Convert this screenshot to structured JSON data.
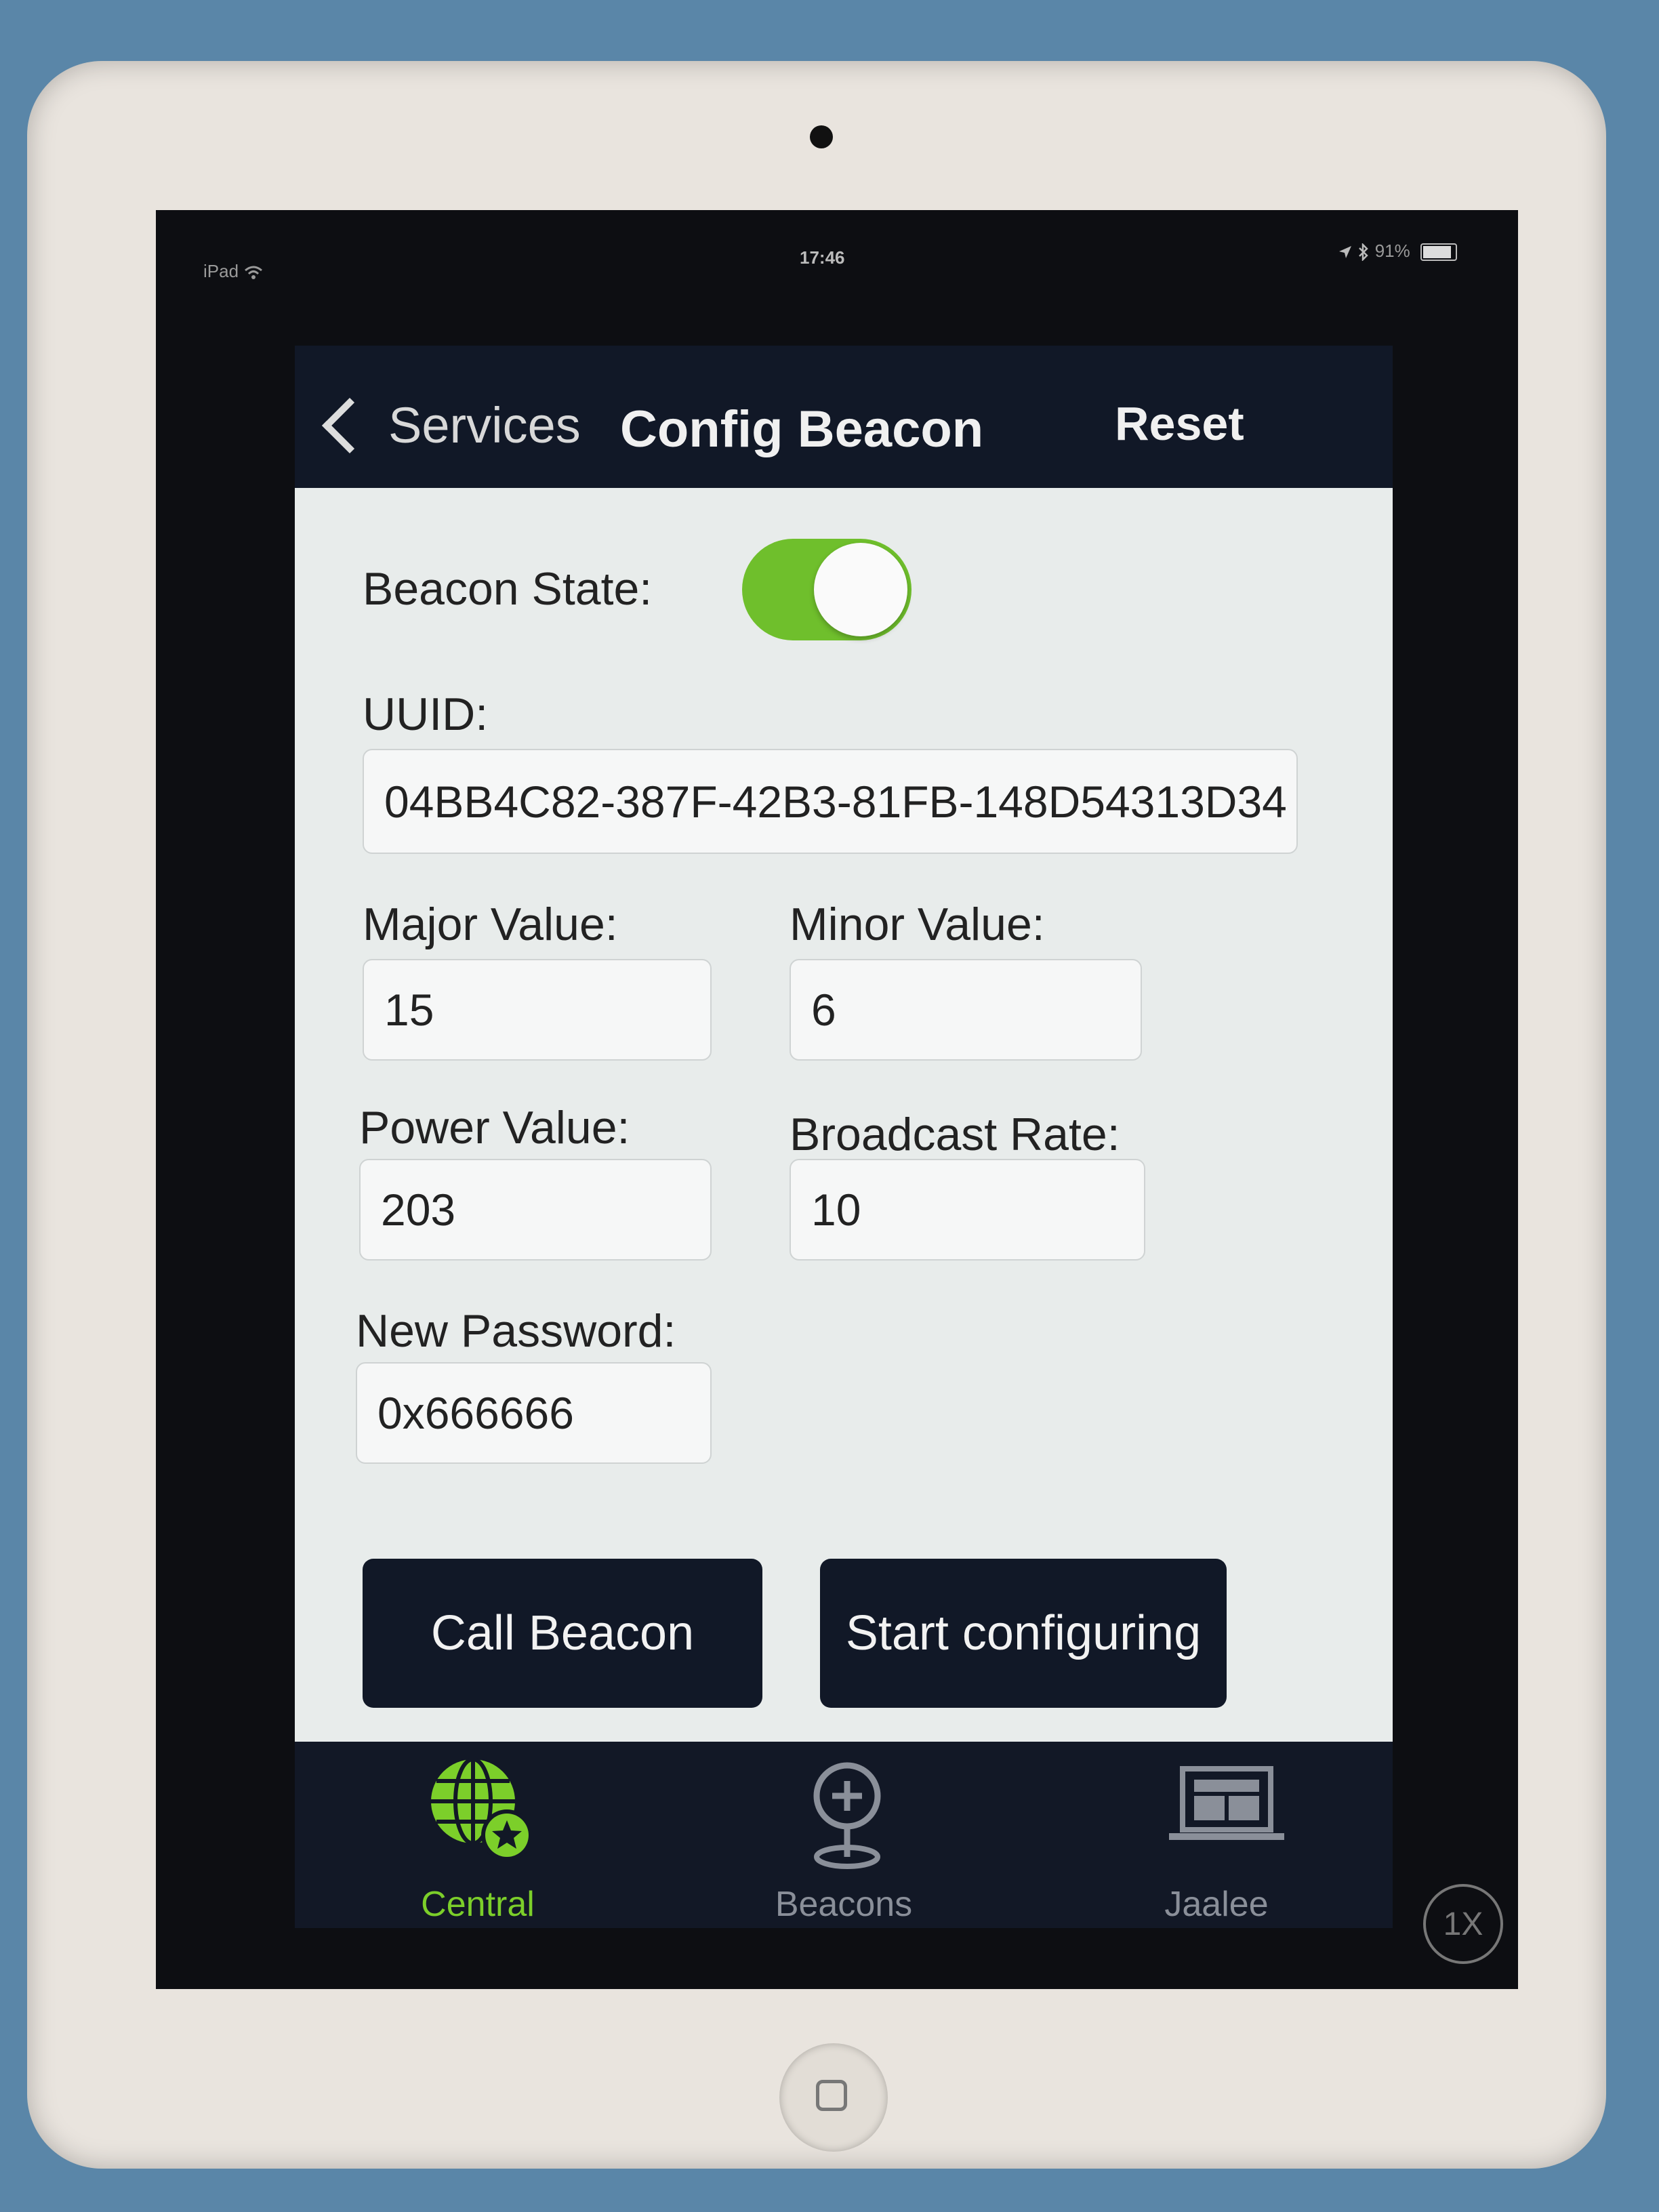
{
  "status_bar": {
    "carrier": "iPad",
    "time": "17:46",
    "battery": "91%"
  },
  "nav": {
    "back_label": "Services",
    "title": "Config Beacon",
    "reset_label": "Reset"
  },
  "form": {
    "beacon_state_label": "Beacon State:",
    "beacon_state_on": true,
    "uuid_label": "UUID:",
    "uuid_value": "04BB4C82-387F-42B3-81FB-148D54313D34",
    "major_label": "Major Value:",
    "major_value": "15",
    "minor_label": "Minor Value:",
    "minor_value": "6",
    "power_label": "Power Value:",
    "power_value": "203",
    "rate_label": "Broadcast Rate:",
    "rate_value": "10",
    "password_label": "New Password:",
    "password_value": "0x666666"
  },
  "buttons": {
    "call_beacon": "Call Beacon",
    "start_configuring": "Start configuring"
  },
  "tabs": [
    {
      "label": "Central",
      "icon": "globe-star-icon",
      "active": true
    },
    {
      "label": "Beacons",
      "icon": "map-pin-plus-icon",
      "active": false
    },
    {
      "label": "Jaalee",
      "icon": "laptop-icon",
      "active": false
    }
  ],
  "zoom_badge": "1X",
  "colors": {
    "accent_green": "#7ccf2a",
    "nav_dark": "#111827",
    "toggle_on": "#6fbf2c",
    "tab_inactive": "#8a8f99"
  }
}
